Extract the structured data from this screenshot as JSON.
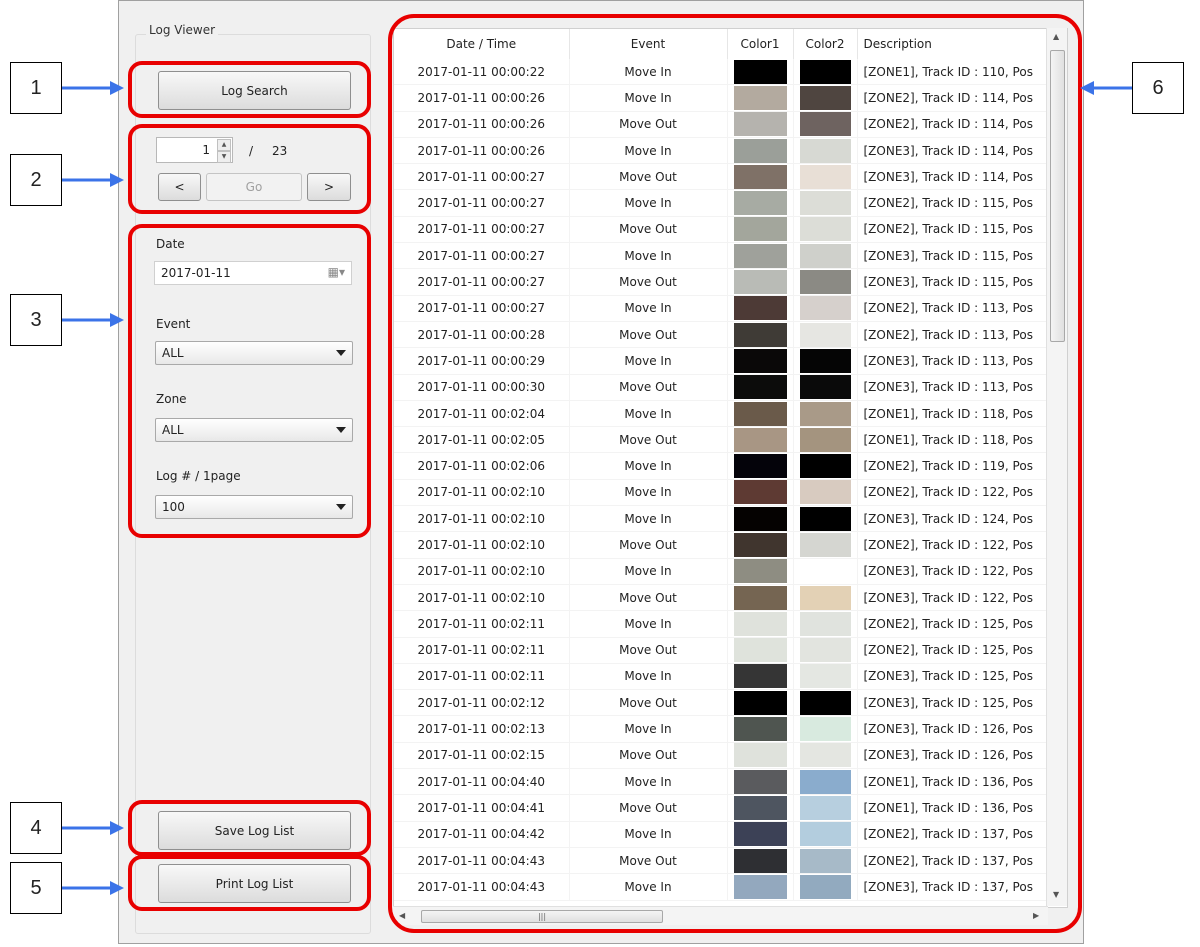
{
  "group_title": "Log Viewer",
  "buttons": {
    "log_search": "Log Search",
    "prev": "<",
    "go": "Go",
    "next": ">",
    "save_log_list": "Save Log List",
    "print_log_list": "Print Log List"
  },
  "paging": {
    "current_page": "1",
    "separator": "/",
    "total_pages": "23"
  },
  "filters": {
    "date_label": "Date",
    "date_value": "2017-01-11",
    "event_label": "Event",
    "event_value": "ALL",
    "zone_label": "Zone",
    "zone_value": "ALL",
    "logs_per_page_label": "Log # / 1page",
    "logs_per_page_value": "100"
  },
  "callouts": [
    "1",
    "2",
    "3",
    "4",
    "5",
    "6"
  ],
  "table": {
    "columns": [
      "Date / Time",
      "Event",
      "Color1",
      "Color2",
      "Description"
    ],
    "rows": [
      {
        "datetime": "2017-01-11 00:00:22",
        "event": "Move In",
        "color1": "#000000",
        "color2": "#000000",
        "description": "[ZONE1], Track ID : 110, Pos"
      },
      {
        "datetime": "2017-01-11 00:00:26",
        "event": "Move In",
        "color1": "#b3aa9f",
        "color2": "#4f4540",
        "description": "[ZONE2], Track ID : 114, Pos"
      },
      {
        "datetime": "2017-01-11 00:00:26",
        "event": "Move Out",
        "color1": "#b5b3ae",
        "color2": "#6e6360",
        "description": "[ZONE2], Track ID : 114, Pos"
      },
      {
        "datetime": "2017-01-11 00:00:26",
        "event": "Move In",
        "color1": "#9b9f99",
        "color2": "#d7d9d3",
        "description": "[ZONE3], Track ID : 114, Pos"
      },
      {
        "datetime": "2017-01-11 00:00:27",
        "event": "Move Out",
        "color1": "#7f7167",
        "color2": "#e8dfd6",
        "description": "[ZONE3], Track ID : 114, Pos"
      },
      {
        "datetime": "2017-01-11 00:00:27",
        "event": "Move In",
        "color1": "#a7aba3",
        "color2": "#dcddd7",
        "description": "[ZONE2], Track ID : 115, Pos"
      },
      {
        "datetime": "2017-01-11 00:00:27",
        "event": "Move Out",
        "color1": "#a3a69c",
        "color2": "#dcddd7",
        "description": "[ZONE2], Track ID : 115, Pos"
      },
      {
        "datetime": "2017-01-11 00:00:27",
        "event": "Move In",
        "color1": "#9fa19b",
        "color2": "#cfd0cb",
        "description": "[ZONE3], Track ID : 115, Pos"
      },
      {
        "datetime": "2017-01-11 00:00:27",
        "event": "Move Out",
        "color1": "#b9bbb6",
        "color2": "#8b8a84",
        "description": "[ZONE3], Track ID : 115, Pos"
      },
      {
        "datetime": "2017-01-11 00:00:27",
        "event": "Move In",
        "color1": "#4d3a36",
        "color2": "#d6d0cc",
        "description": "[ZONE2], Track ID : 113, Pos"
      },
      {
        "datetime": "2017-01-11 00:00:28",
        "event": "Move Out",
        "color1": "#3f3b36",
        "color2": "#e6e6e2",
        "description": "[ZONE2], Track ID : 113, Pos"
      },
      {
        "datetime": "2017-01-11 00:00:29",
        "event": "Move In",
        "color1": "#0a0808",
        "color2": "#050505",
        "description": "[ZONE3], Track ID : 113, Pos"
      },
      {
        "datetime": "2017-01-11 00:00:30",
        "event": "Move Out",
        "color1": "#0c0c0b",
        "color2": "#0a0a0a",
        "description": "[ZONE3], Track ID : 113, Pos"
      },
      {
        "datetime": "2017-01-11 00:02:04",
        "event": "Move In",
        "color1": "#6a5a4a",
        "color2": "#a99a88",
        "description": "[ZONE1], Track ID : 118, Pos"
      },
      {
        "datetime": "2017-01-11 00:02:05",
        "event": "Move Out",
        "color1": "#a89684",
        "color2": "#a4947f",
        "description": "[ZONE1], Track ID : 118, Pos"
      },
      {
        "datetime": "2017-01-11 00:02:06",
        "event": "Move In",
        "color1": "#04030a",
        "color2": "#000000",
        "description": "[ZONE2], Track ID : 119, Pos"
      },
      {
        "datetime": "2017-01-11 00:02:10",
        "event": "Move In",
        "color1": "#5e3a33",
        "color2": "#d8cbc0",
        "description": "[ZONE2], Track ID : 122, Pos"
      },
      {
        "datetime": "2017-01-11 00:02:10",
        "event": "Move In",
        "color1": "#050201",
        "color2": "#000000",
        "description": "[ZONE3], Track ID : 124, Pos"
      },
      {
        "datetime": "2017-01-11 00:02:10",
        "event": "Move Out",
        "color1": "#40352e",
        "color2": "#d5d6d1",
        "description": "[ZONE2], Track ID : 122, Pos"
      },
      {
        "datetime": "2017-01-11 00:02:10",
        "event": "Move In",
        "color1": "#8e8d82",
        "color2": "#ffffff",
        "description": "[ZONE3], Track ID : 122, Pos"
      },
      {
        "datetime": "2017-01-11 00:02:10",
        "event": "Move Out",
        "color1": "#756552",
        "color2": "#e3d1b5",
        "description": "[ZONE3], Track ID : 122, Pos"
      },
      {
        "datetime": "2017-01-11 00:02:11",
        "event": "Move In",
        "color1": "#dfe2dc",
        "color2": "#e0e3de",
        "description": "[ZONE2], Track ID : 125, Pos"
      },
      {
        "datetime": "2017-01-11 00:02:11",
        "event": "Move Out",
        "color1": "#dfe3dc",
        "color2": "#e2e4df",
        "description": "[ZONE2], Track ID : 125, Pos"
      },
      {
        "datetime": "2017-01-11 00:02:11",
        "event": "Move In",
        "color1": "#353535",
        "color2": "#e4e7e2",
        "description": "[ZONE3], Track ID : 125, Pos"
      },
      {
        "datetime": "2017-01-11 00:02:12",
        "event": "Move Out",
        "color1": "#000000",
        "color2": "#000000",
        "description": "[ZONE3], Track ID : 125, Pos"
      },
      {
        "datetime": "2017-01-11 00:02:13",
        "event": "Move In",
        "color1": "#4f5550",
        "color2": "#d8eadf",
        "description": "[ZONE3], Track ID : 126, Pos"
      },
      {
        "datetime": "2017-01-11 00:02:15",
        "event": "Move Out",
        "color1": "#dfe2dc",
        "color2": "#e4e6e1",
        "description": "[ZONE3], Track ID : 126, Pos"
      },
      {
        "datetime": "2017-01-11 00:04:40",
        "event": "Move In",
        "color1": "#5a5b5e",
        "color2": "#8aaccd",
        "description": "[ZONE1], Track ID : 136, Pos"
      },
      {
        "datetime": "2017-01-11 00:04:41",
        "event": "Move Out",
        "color1": "#4e5560",
        "color2": "#b7cfdf",
        "description": "[ZONE1], Track ID : 136, Pos"
      },
      {
        "datetime": "2017-01-11 00:04:42",
        "event": "Move In",
        "color1": "#3c4156",
        "color2": "#b3cdde",
        "description": "[ZONE2], Track ID : 137, Pos"
      },
      {
        "datetime": "2017-01-11 00:04:43",
        "event": "Move Out",
        "color1": "#2e2f33",
        "color2": "#a7bac8",
        "description": "[ZONE2], Track ID : 137, Pos"
      },
      {
        "datetime": "2017-01-11 00:04:43",
        "event": "Move In",
        "color1": "#93a8be",
        "color2": "#92aabf",
        "description": "[ZONE3], Track ID : 137, Pos"
      }
    ]
  },
  "colors": {
    "annotation": "#e80000",
    "arrow": "#3b73e8"
  }
}
